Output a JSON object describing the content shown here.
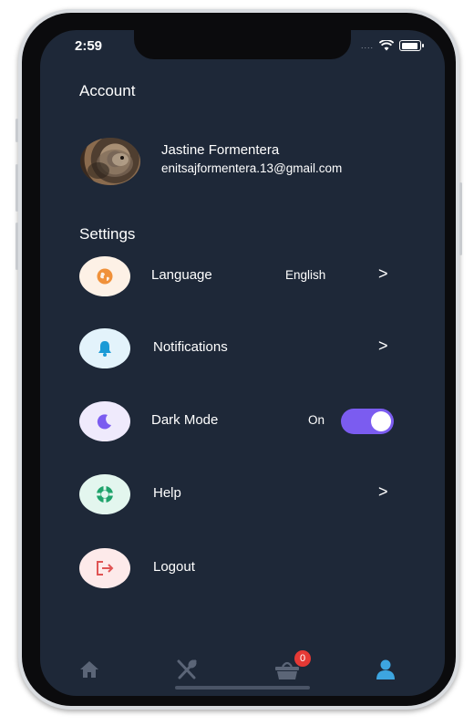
{
  "status_bar": {
    "time": "2:59",
    "signal_dots": "....",
    "wifi_icon": "wifi-icon",
    "battery_icon": "battery-icon"
  },
  "account": {
    "title": "Account",
    "avatar_icon": "cat-avatar-photo",
    "name": "Jastine Formentera",
    "email": "enitsajformentera.13@gmail.com"
  },
  "settings": {
    "title": "Settings",
    "items": [
      {
        "label": "Language",
        "value": "English",
        "chevron": ">",
        "icon": "globe-icon",
        "icon_bg": "#fdf1e6",
        "icon_color": "#f0913a"
      },
      {
        "label": "Notifications",
        "value": "",
        "chevron": ">",
        "icon": "bell-icon",
        "icon_bg": "#e3f3fb",
        "icon_color": "#1a9ad6"
      },
      {
        "label": "Dark Mode",
        "value": "On",
        "toggle_on": true,
        "icon": "moon-icon",
        "icon_bg": "#efeafc",
        "icon_color": "#7b5cf0"
      },
      {
        "label": "Help",
        "value": "",
        "chevron": ">",
        "icon": "lifebuoy-icon",
        "icon_bg": "#e3f6ee",
        "icon_color": "#1fa36b"
      },
      {
        "label": "Logout",
        "value": "",
        "icon": "logout-icon",
        "icon_bg": "#fdeaea",
        "icon_color": "#e05454"
      }
    ]
  },
  "tab_bar": {
    "tabs": [
      "home-icon",
      "utensils-icon",
      "basket-icon",
      "user-icon"
    ],
    "cart_badge": "0",
    "active_tab": "user-icon",
    "active_color": "#3da5e0",
    "inactive_color": "#5b6577"
  }
}
